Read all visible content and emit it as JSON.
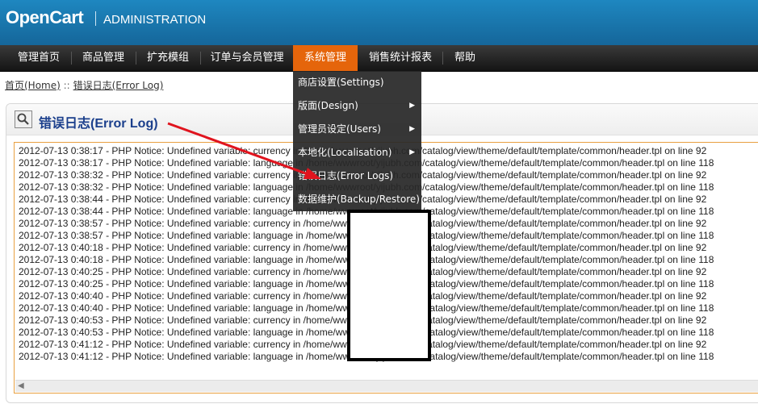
{
  "header": {
    "logo": "OpenCart",
    "subtitle": "ADMINISTRATION"
  },
  "menu": [
    {
      "label": "管理首页"
    },
    {
      "label": "商品管理"
    },
    {
      "label": "扩充模组"
    },
    {
      "label": "订单与会员管理"
    },
    {
      "label": "系统管理",
      "active": true
    },
    {
      "label": "销售统计报表"
    },
    {
      "label": "帮助"
    }
  ],
  "dropdown": [
    {
      "label": "商店设置(Settings)",
      "submenu": false
    },
    {
      "label": "版面(Design)",
      "submenu": true
    },
    {
      "label": "管理员设定(Users)",
      "submenu": true
    },
    {
      "label": "本地化(Localisation)",
      "submenu": true
    },
    {
      "label": "错误日志(Error Logs)",
      "submenu": false
    },
    {
      "label": "数据维护(Backup/Restore)",
      "submenu": false
    }
  ],
  "breadcrumb": {
    "home": "首页(Home)",
    "separator": "::",
    "current": "错误日志(Error Log)"
  },
  "page": {
    "title": "错误日志(Error Log)"
  },
  "log": [
    "2012-07-13 0:38:17 - PHP Notice:  Undefined variable: currency in /home/wwwroot/yijubh.com/catalog/view/theme/default/template/common/header.tpl on line 92",
    "2012-07-13 0:38:17 - PHP Notice:  Undefined variable: language in /home/wwwroot/yijubh.com/catalog/view/theme/default/template/common/header.tpl on line 118",
    "2012-07-13 0:38:32 - PHP Notice:  Undefined variable: currency in /home/wwwroot/yijubh.com/catalog/view/theme/default/template/common/header.tpl on line 92",
    "2012-07-13 0:38:32 - PHP Notice:  Undefined variable: language in /home/wwwroot/yijubh.com/catalog/view/theme/default/template/common/header.tpl on line 118",
    "2012-07-13 0:38:44 - PHP Notice:  Undefined variable: currency in /home/wwwroot/yijubh.com/catalog/view/theme/default/template/common/header.tpl on line 92",
    "2012-07-13 0:38:44 - PHP Notice:  Undefined variable: language in /home/wwwroot/yijubh.com/catalog/view/theme/default/template/common/header.tpl on line 118",
    "2012-07-13 0:38:57 - PHP Notice:  Undefined variable: currency in /home/wwwroot/yijubh.com/catalog/view/theme/default/template/common/header.tpl on line 92",
    "2012-07-13 0:38:57 - PHP Notice:  Undefined variable: language in /home/wwwroot/yijubh.com/catalog/view/theme/default/template/common/header.tpl on line 118",
    "2012-07-13 0:40:18 - PHP Notice:  Undefined variable: currency in /home/wwwroot/yijubh.com/catalog/view/theme/default/template/common/header.tpl on line 92",
    "2012-07-13 0:40:18 - PHP Notice:  Undefined variable: language in /home/wwwroot/yijubh.com/catalog/view/theme/default/template/common/header.tpl on line 118",
    "2012-07-13 0:40:25 - PHP Notice:  Undefined variable: currency in /home/wwwroot/yijubh.com/catalog/view/theme/default/template/common/header.tpl on line 92",
    "2012-07-13 0:40:25 - PHP Notice:  Undefined variable: language in /home/wwwroot/yijubh.com/catalog/view/theme/default/template/common/header.tpl on line 118",
    "2012-07-13 0:40:40 - PHP Notice:  Undefined variable: currency in /home/wwwroot/yijubh.com/catalog/view/theme/default/template/common/header.tpl on line 92",
    "2012-07-13 0:40:40 - PHP Notice:  Undefined variable: language in /home/wwwroot/yijubh.com/catalog/view/theme/default/template/common/header.tpl on line 118",
    "2012-07-13 0:40:53 - PHP Notice:  Undefined variable: currency in /home/wwwroot/yijubh.com/catalog/view/theme/default/template/common/header.tpl on line 92",
    "2012-07-13 0:40:53 - PHP Notice:  Undefined variable: language in /home/wwwroot/yijubh.com/catalog/view/theme/default/template/common/header.tpl on line 118",
    "2012-07-13 0:41:12 - PHP Notice:  Undefined variable: currency in /home/wwwroot/yijubh.com/catalog/view/theme/default/template/common/header.tpl on line 92",
    "2012-07-13 0:41:12 - PHP Notice:  Undefined variable: language in /home/wwwroot/yijubh.com/catalog/view/theme/default/template/common/header.tpl on line 118"
  ],
  "colors": {
    "header": "#1a78b0",
    "menu_active": "#e5650b",
    "annotation_arrow": "#e0141e"
  }
}
